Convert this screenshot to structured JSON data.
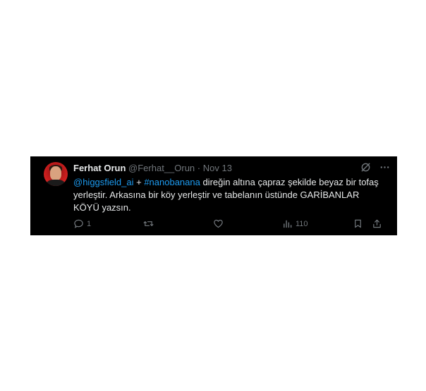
{
  "tweet": {
    "author_name": "Ferhat Orun",
    "author_handle": "@Ferhat__Orun",
    "separator": "·",
    "date": "Nov 13",
    "body": {
      "mention": "@higgsfield_ai",
      "plus": " + ",
      "hashtag": "#nanobanana",
      "text": " direğin altına çapraz şekilde beyaz bir tofaş yerleştir. Arkasına bir köy yerleştir ve tabelanın üstünde GARİBANLAR KÖYÜ yazsın."
    },
    "actions": {
      "reply_count": "1",
      "views_count": "110"
    },
    "icons": {
      "header": [
        "grok-icon",
        "more-icon"
      ],
      "actions": [
        "reply-icon",
        "retweet-icon",
        "like-icon",
        "views-icon",
        "bookmark-icon",
        "share-icon"
      ]
    },
    "colors": {
      "background": "#000000",
      "text": "#e7e9ea",
      "muted": "#71767b",
      "link": "#1d9bf0",
      "avatar_bg": "#c81d1d"
    }
  }
}
